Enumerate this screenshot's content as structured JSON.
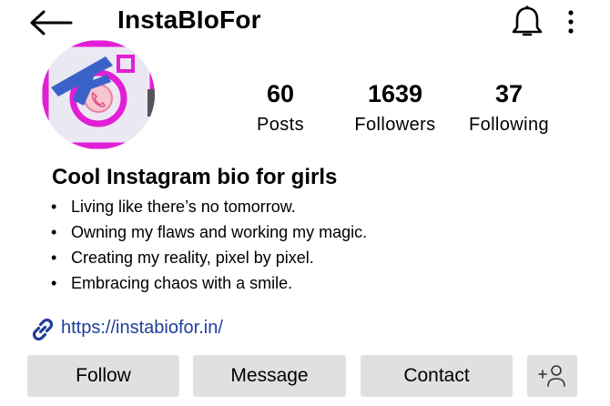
{
  "header": {
    "title": "InstaBIoFor",
    "back_icon": "arrow-left-icon",
    "notification_icon": "bell-icon",
    "menu_icon": "more-vertical-icon"
  },
  "profile": {
    "avatar_icon": "camera-logo-icon",
    "stats": [
      {
        "value": "60",
        "label": "Posts"
      },
      {
        "value": "1639",
        "label": "Followers"
      },
      {
        "value": "37",
        "label": "Following"
      }
    ]
  },
  "bio": {
    "title": "Cool Instagram bio for girls",
    "items": [
      "Living like there’s no tomorrow.",
      "Owning my flaws and working my magic.",
      "Creating my reality, pixel by pixel.",
      "Embracing chaos with a smile."
    ]
  },
  "link": {
    "icon": "link-icon",
    "url": "https://instabiofor.in/",
    "color": "#1f3f9a"
  },
  "actions": {
    "follow_label": "Follow",
    "message_label": "Message",
    "contact_label": "Contact",
    "add_user_icon": "add-user-icon",
    "button_color": "#e0e0e0"
  }
}
